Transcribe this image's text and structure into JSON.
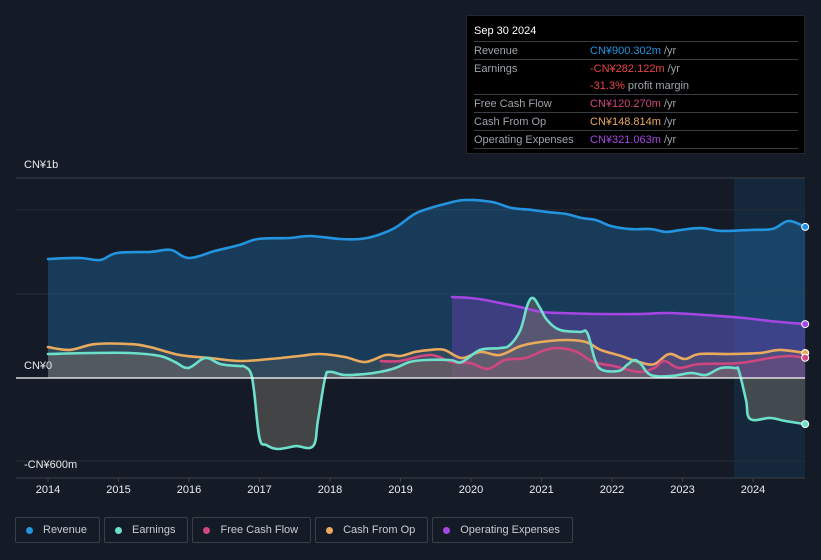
{
  "tooltip": {
    "date": "Sep 30 2024",
    "rows": [
      {
        "label": "Revenue",
        "value": "CN¥900.302m",
        "suffix": " /yr",
        "color": "#2394df"
      },
      {
        "label": "Earnings",
        "value": "-CN¥282.122m",
        "suffix": " /yr",
        "color": "#e64545"
      },
      {
        "label": "",
        "value": "-31.3%",
        "suffix": " profit margin",
        "color": "#e64545"
      },
      {
        "label": "Free Cash Flow",
        "value": "CN¥120.270m",
        "suffix": " /yr",
        "color": "#d0467e"
      },
      {
        "label": "Cash From Op",
        "value": "CN¥148.814m",
        "suffix": " /yr",
        "color": "#eaaa5d"
      },
      {
        "label": "Operating Expenses",
        "value": "CN¥321.063m",
        "suffix": " /yr",
        "color": "#a546e4"
      }
    ]
  },
  "legend": [
    {
      "label": "Revenue",
      "color": "#2394df"
    },
    {
      "label": "Earnings",
      "color": "#6ce0ca"
    },
    {
      "label": "Free Cash Flow",
      "color": "#d0467e"
    },
    {
      "label": "Cash From Op",
      "color": "#eaaa5d"
    },
    {
      "label": "Operating Expenses",
      "color": "#a546e4"
    }
  ],
  "chart_data": {
    "type": "line",
    "title": "",
    "xlabel": "",
    "ylabel": "",
    "y_unit": "CN¥ millions",
    "y_tick_labels": [
      {
        "value": 1000,
        "label": "CN¥1b"
      },
      {
        "value": 0,
        "label": "CN¥0"
      },
      {
        "value": -600,
        "label": "-CN¥600m"
      }
    ],
    "ylim": [
      -600,
      1190
    ],
    "xlim": [
      2014,
      2024.75
    ],
    "x_ticks": [
      "2014",
      "2015",
      "2016",
      "2017",
      "2018",
      "2019",
      "2020",
      "2021",
      "2022",
      "2023",
      "2024"
    ],
    "highlight_from": 2023.73,
    "grid": true,
    "legend_position": "bottom",
    "series": [
      {
        "name": "Revenue",
        "color": "#2394df",
        "points": [
          [
            2014.0,
            708
          ],
          [
            2014.45,
            714
          ],
          [
            2014.74,
            702
          ],
          [
            2014.98,
            744
          ],
          [
            2015.45,
            750
          ],
          [
            2015.74,
            762
          ],
          [
            2016.0,
            714
          ],
          [
            2016.37,
            756
          ],
          [
            2016.72,
            792
          ],
          [
            2016.98,
            827
          ],
          [
            2017.43,
            833
          ],
          [
            2017.72,
            845
          ],
          [
            2018.14,
            827
          ],
          [
            2018.43,
            827
          ],
          [
            2018.64,
            845
          ],
          [
            2018.92,
            893
          ],
          [
            2019.2,
            976
          ],
          [
            2019.43,
            1012
          ],
          [
            2019.62,
            1035
          ],
          [
            2019.91,
            1059
          ],
          [
            2020.3,
            1047
          ],
          [
            2020.57,
            1012
          ],
          [
            2020.86,
            1000
          ],
          [
            2021.07,
            988
          ],
          [
            2021.35,
            976
          ],
          [
            2021.57,
            952
          ],
          [
            2021.77,
            940
          ],
          [
            2021.99,
            904
          ],
          [
            2022.27,
            886
          ],
          [
            2022.55,
            886
          ],
          [
            2022.77,
            869
          ],
          [
            2022.98,
            881
          ],
          [
            2023.26,
            892
          ],
          [
            2023.55,
            875
          ],
          [
            2023.97,
            881
          ],
          [
            2024.28,
            887
          ],
          [
            2024.5,
            934
          ],
          [
            2024.74,
            899
          ]
        ]
      },
      {
        "name": "Earnings",
        "color": "#6ce0ca",
        "points": [
          [
            2014.0,
            143
          ],
          [
            2014.6,
            149
          ],
          [
            2015.16,
            149
          ],
          [
            2015.59,
            131
          ],
          [
            2015.8,
            95
          ],
          [
            2015.99,
            60
          ],
          [
            2016.23,
            119
          ],
          [
            2016.45,
            83
          ],
          [
            2016.72,
            71
          ],
          [
            2016.77,
            71
          ],
          [
            2016.87,
            36
          ],
          [
            2016.92,
            -71
          ],
          [
            2017.0,
            -357
          ],
          [
            2017.1,
            -399
          ],
          [
            2017.24,
            -422
          ],
          [
            2017.38,
            -416
          ],
          [
            2017.52,
            -405
          ],
          [
            2017.76,
            -405
          ],
          [
            2017.83,
            -250
          ],
          [
            2017.93,
            0
          ],
          [
            2018.0,
            36
          ],
          [
            2018.21,
            18
          ],
          [
            2018.5,
            24
          ],
          [
            2018.71,
            36
          ],
          [
            2018.92,
            59
          ],
          [
            2019.13,
            95
          ],
          [
            2019.35,
            107
          ],
          [
            2019.7,
            107
          ],
          [
            2019.87,
            95
          ],
          [
            2020.13,
            167
          ],
          [
            2020.41,
            178
          ],
          [
            2020.55,
            196
          ],
          [
            2020.7,
            286
          ],
          [
            2020.8,
            434
          ],
          [
            2020.88,
            476
          ],
          [
            2020.98,
            416
          ],
          [
            2021.08,
            345
          ],
          [
            2021.26,
            286
          ],
          [
            2021.54,
            274
          ],
          [
            2021.65,
            268
          ],
          [
            2021.76,
            107
          ],
          [
            2021.86,
            48
          ],
          [
            2022.1,
            42
          ],
          [
            2022.21,
            77
          ],
          [
            2022.32,
            107
          ],
          [
            2022.41,
            83
          ],
          [
            2022.55,
            18
          ],
          [
            2022.84,
            12
          ],
          [
            2023.12,
            30
          ],
          [
            2023.33,
            18
          ],
          [
            2023.54,
            59
          ],
          [
            2023.75,
            59
          ],
          [
            2023.8,
            42
          ],
          [
            2023.9,
            -131
          ],
          [
            2023.96,
            -244
          ],
          [
            2024.25,
            -238
          ],
          [
            2024.46,
            -256
          ],
          [
            2024.74,
            -274
          ]
        ]
      },
      {
        "name": "Free Cash Flow",
        "color": "#d0467e",
        "points": [
          [
            2018.72,
            101
          ],
          [
            2018.99,
            101
          ],
          [
            2019.42,
            137
          ],
          [
            2019.73,
            95
          ],
          [
            2019.99,
            89
          ],
          [
            2020.24,
            54
          ],
          [
            2020.48,
            107
          ],
          [
            2020.77,
            119
          ],
          [
            2021.06,
            167
          ],
          [
            2021.26,
            178
          ],
          [
            2021.5,
            155
          ],
          [
            2021.74,
            95
          ],
          [
            2022.03,
            71
          ],
          [
            2022.38,
            36
          ],
          [
            2022.6,
            60
          ],
          [
            2022.74,
            101
          ],
          [
            2022.95,
            60
          ],
          [
            2023.24,
            83
          ],
          [
            2023.81,
            89
          ],
          [
            2024.24,
            119
          ],
          [
            2024.52,
            131
          ],
          [
            2024.74,
            120
          ]
        ]
      },
      {
        "name": "Cash From Op",
        "color": "#eaaa5d",
        "points": [
          [
            2014.0,
            184
          ],
          [
            2014.31,
            167
          ],
          [
            2014.67,
            202
          ],
          [
            2015.16,
            202
          ],
          [
            2015.45,
            184
          ],
          [
            2015.87,
            137
          ],
          [
            2016.3,
            119
          ],
          [
            2016.72,
            101
          ],
          [
            2017.15,
            113
          ],
          [
            2017.57,
            131
          ],
          [
            2017.86,
            143
          ],
          [
            2018.21,
            125
          ],
          [
            2018.5,
            95
          ],
          [
            2018.79,
            137
          ],
          [
            2019.0,
            131
          ],
          [
            2019.21,
            155
          ],
          [
            2019.42,
            167
          ],
          [
            2019.62,
            167
          ],
          [
            2019.87,
            119
          ],
          [
            2020.13,
            155
          ],
          [
            2020.41,
            137
          ],
          [
            2020.7,
            190
          ],
          [
            2020.99,
            214
          ],
          [
            2021.34,
            226
          ],
          [
            2021.63,
            214
          ],
          [
            2021.84,
            167
          ],
          [
            2022.13,
            131
          ],
          [
            2022.38,
            95
          ],
          [
            2022.6,
            83
          ],
          [
            2022.81,
            143
          ],
          [
            2023.03,
            113
          ],
          [
            2023.24,
            143
          ],
          [
            2023.67,
            143
          ],
          [
            2024.1,
            149
          ],
          [
            2024.38,
            167
          ],
          [
            2024.74,
            149
          ]
        ]
      },
      {
        "name": "Operating Expenses",
        "color": "#a546e4",
        "points": [
          [
            2019.73,
            482
          ],
          [
            2019.99,
            476
          ],
          [
            2020.2,
            464
          ],
          [
            2020.49,
            440
          ],
          [
            2020.7,
            422
          ],
          [
            2020.99,
            393
          ],
          [
            2021.27,
            387
          ],
          [
            2021.84,
            381
          ],
          [
            2022.4,
            381
          ],
          [
            2022.75,
            387
          ],
          [
            2023.1,
            381
          ],
          [
            2023.52,
            369
          ],
          [
            2023.88,
            357
          ],
          [
            2024.24,
            339
          ],
          [
            2024.74,
            321
          ]
        ]
      }
    ]
  }
}
